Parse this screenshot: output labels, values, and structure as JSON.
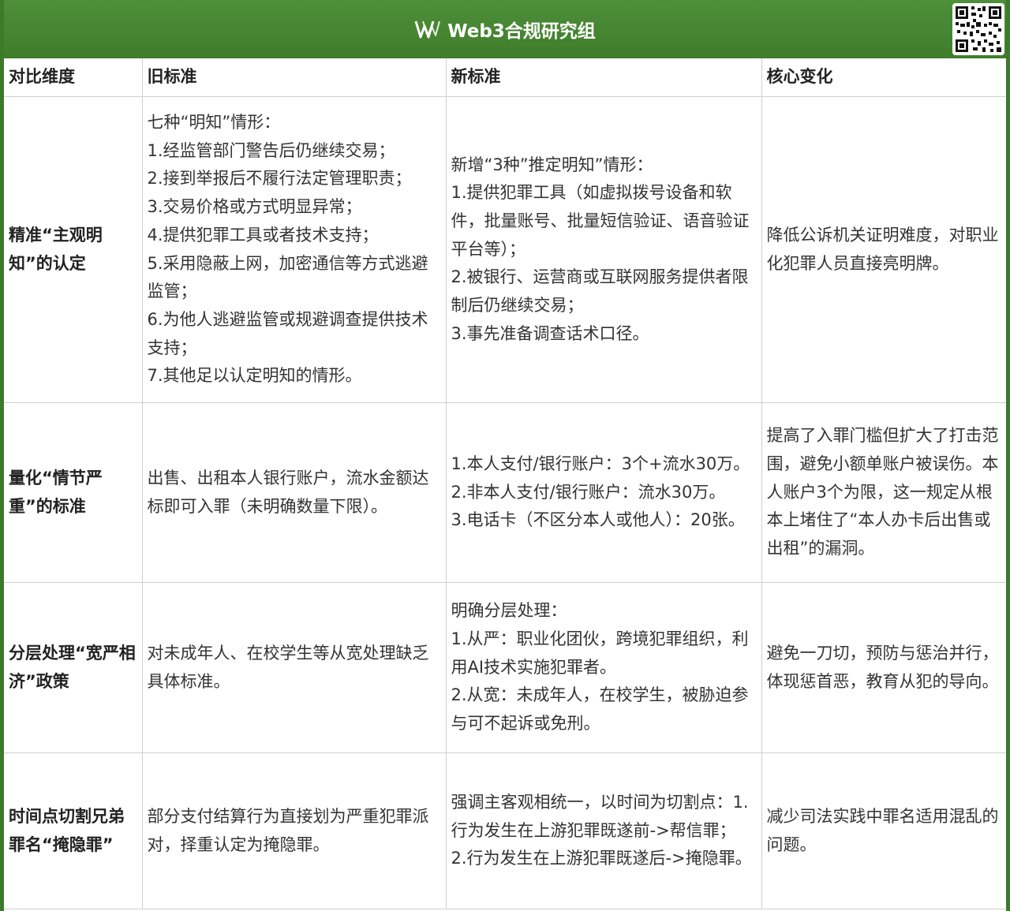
{
  "header": {
    "title": "Web3合规研究组",
    "logo_icon": "w-logo-icon",
    "qr_icon": "qr-code-icon",
    "brand_color": "#3f7d2b"
  },
  "table": {
    "columns": [
      "对比维度",
      "旧标准",
      "新标准",
      "核心变化"
    ],
    "rows": [
      {
        "dimension": "精准“主观明知”的认定",
        "old": "七种“明知”情形：\n1.经监管部门警告后仍继续交易；\n2.接到举报后不履行法定管理职责；\n3.交易价格或方式明显异常；\n4.提供犯罪工具或者技术支持；\n5.采用隐蔽上网，加密通信等方式逃避监管；\n6.为他人逃避监管或规避调查提供技术支持；\n7.其他足以认定明知的情形。",
        "new": "新增“3种”推定明知”情形：\n1.提供犯罪工具（如虚拟拨号设备和软件，批量账号、批量短信验证、语音验证平台等）；\n2.被银行、运营商或互联网服务提供者限制后仍继续交易；\n3.事先准备调查话术口径。",
        "change": "降低公诉机关证明难度，对职业化犯罪人员直接亮明牌。"
      },
      {
        "dimension": "量化“情节严重”的标准",
        "old": "出售、出租本人银行账户，流水金额达标即可入罪（未明确数量下限）。",
        "new": "1.本人支付/银行账户：3个+流水30万。\n2.非本人支付/银行账户：流水30万。\n3.电话卡（不区分本人或他人）：20张。",
        "change": "提高了入罪门槛但扩大了打击范围，避免小额单账户被误伤。本人账户3个为限，这一规定从根本上堵住了“本人办卡后出售或出租”的漏洞。"
      },
      {
        "dimension": "分层处理“宽严相济”政策",
        "old": "对未成年人、在校学生等从宽处理缺乏具体标准。",
        "new": "明确分层处理：\n1.从严：职业化团伙，跨境犯罪组织，利用AI技术实施犯罪者。\n2.从宽：未成年人，在校学生，被胁迫参与可不起诉或免刑。",
        "change": "避免一刀切，预防与惩治并行，体现惩首恶，教育从犯的导向。"
      },
      {
        "dimension": "时间点切割兄弟罪名“掩隐罪”",
        "old": "部分支付结算行为直接划为严重犯罪派对，择重认定为掩隐罪。",
        "new": "强调主客观相统一，以时间为切割点：1.行为发生在上游犯罪既遂前->帮信罪；\n2.行为发生在上游犯罪既遂后->掩隐罪。",
        "change": "减少司法实践中罪名适用混乱的问题。"
      }
    ]
  }
}
